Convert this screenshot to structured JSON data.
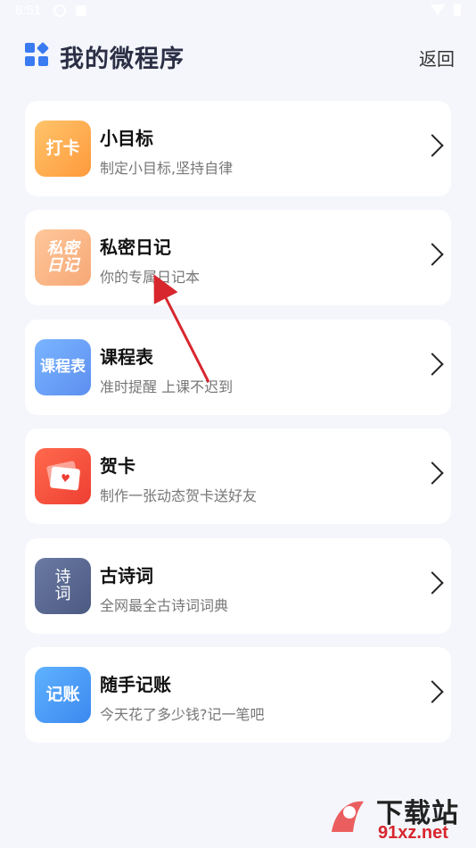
{
  "status_bar": {
    "time": "8:51"
  },
  "header": {
    "title": "我的微程序",
    "back_label": "返回"
  },
  "apps": [
    {
      "icon_text": "打卡",
      "title": "小目标",
      "subtitle": "制定小目标,坚持自律"
    },
    {
      "icon_text": "私密日记",
      "title": "私密日记",
      "subtitle": "你的专属日记本"
    },
    {
      "icon_text": "课程表",
      "title": "课程表",
      "subtitle": "准时提醒 上课不迟到"
    },
    {
      "icon_text": "",
      "title": "贺卡",
      "subtitle": "制作一张动态贺卡送好友"
    },
    {
      "icon_text": "诗词",
      "title": "古诗词",
      "subtitle": "全网最全古诗词词典"
    },
    {
      "icon_text": "记账",
      "title": "随手记账",
      "subtitle": "今天花了多少钱?记一笔吧"
    }
  ],
  "watermark": {
    "line1": "下载站",
    "line2": "91xz.net"
  },
  "colors": {
    "background": "#f4f6fc",
    "accent": "#3b7bf2",
    "annotation_arrow": "#d8262e"
  }
}
